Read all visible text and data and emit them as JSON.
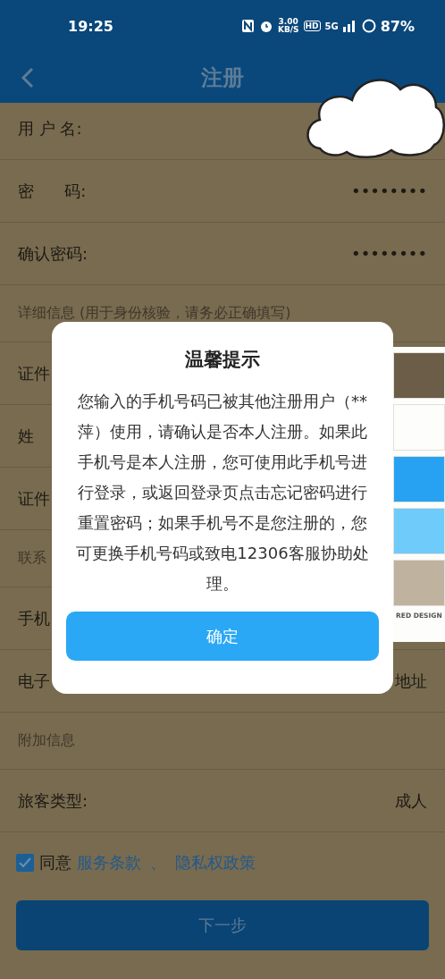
{
  "status_bar": {
    "time": "19:25",
    "speed": "3.00",
    "speed_unit": "KB/S",
    "hd": "HD",
    "network": "5G",
    "battery": "87%"
  },
  "header": {
    "title": "注册"
  },
  "rows": [
    {
      "kind": "field",
      "label": "用 户 名:"
    },
    {
      "kind": "field",
      "label": "密      码:",
      "value": "••••••••"
    },
    {
      "kind": "field",
      "label": "确认密码:",
      "value": "••••••••"
    },
    {
      "kind": "section",
      "label": "详细信息 (用于身份核验，请务必正确填写)"
    },
    {
      "kind": "field",
      "label": "证件"
    },
    {
      "kind": "field",
      "label": "姓"
    },
    {
      "kind": "field",
      "label": "证件"
    },
    {
      "kind": "section",
      "label": "联系"
    },
    {
      "kind": "field",
      "label": "手机"
    },
    {
      "kind": "field",
      "label": "电子",
      "value": "地址"
    },
    {
      "kind": "section",
      "label": "附加信息"
    },
    {
      "kind": "field",
      "label": "旅客类型:",
      "value": "成人"
    }
  ],
  "agreement": {
    "checked": true,
    "text": "同意",
    "links": [
      "服务条款",
      "隐私权政策"
    ],
    "separator": "、"
  },
  "next_button": {
    "label": "下一步"
  },
  "swatch_card": {
    "swatches": [
      {
        "color": "#6b5d48"
      },
      {
        "color": "#fdfdfb"
      },
      {
        "color": "#27a2f3"
      },
      {
        "color": "#6fcbfa"
      },
      {
        "color": "#bfb39f"
      }
    ],
    "label": "RED DESIGN"
  },
  "dialog": {
    "title": "温馨提示",
    "message": "您输入的手机号码已被其他注册用户（**萍）使用，请确认是否本人注册。如果此手机号是本人注册，您可使用此手机号进行登录，或返回登录页点击忘记密码进行重置密码；如果手机号不是您注册的，您可更换手机号码或致电12306客服协助处理。",
    "button": "确定"
  }
}
